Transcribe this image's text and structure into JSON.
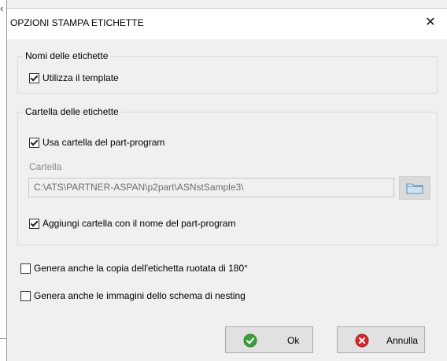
{
  "dialog": {
    "title": "OPZIONI STAMPA ETICHETTE",
    "close_glyph": "✕"
  },
  "names_group": {
    "legend": "Nomi delle etichette",
    "use_template": {
      "label": "Utilizza il template",
      "checked": true
    }
  },
  "folder_group": {
    "legend": "Cartella delle etichette",
    "use_part_program_folder": {
      "label": "Usa cartella del part-program",
      "checked": true
    },
    "folder_label": "Cartella",
    "folder_value": "C:\\ATS\\PARTNER-ASPAN\\p2part\\ASNstSample3\\",
    "add_folder_with_name": {
      "label": "Aggiungi cartella con il nome del part-program",
      "checked": true
    }
  },
  "options": {
    "rotated_copy": {
      "label": "Genera anche la copia dell'etichetta ruotata di 180°",
      "checked": false
    },
    "nesting_images": {
      "label": "Genera anche le immagini dello schema di nesting",
      "checked": false
    }
  },
  "buttons": {
    "ok_label": "Ok",
    "cancel_label": "Annulla"
  },
  "icons": {
    "ok": "green-check-icon",
    "cancel": "red-x-icon",
    "browse": "folder-icon"
  },
  "colors": {
    "ok_green": "#3aa23a",
    "cancel_red": "#d9262b"
  }
}
